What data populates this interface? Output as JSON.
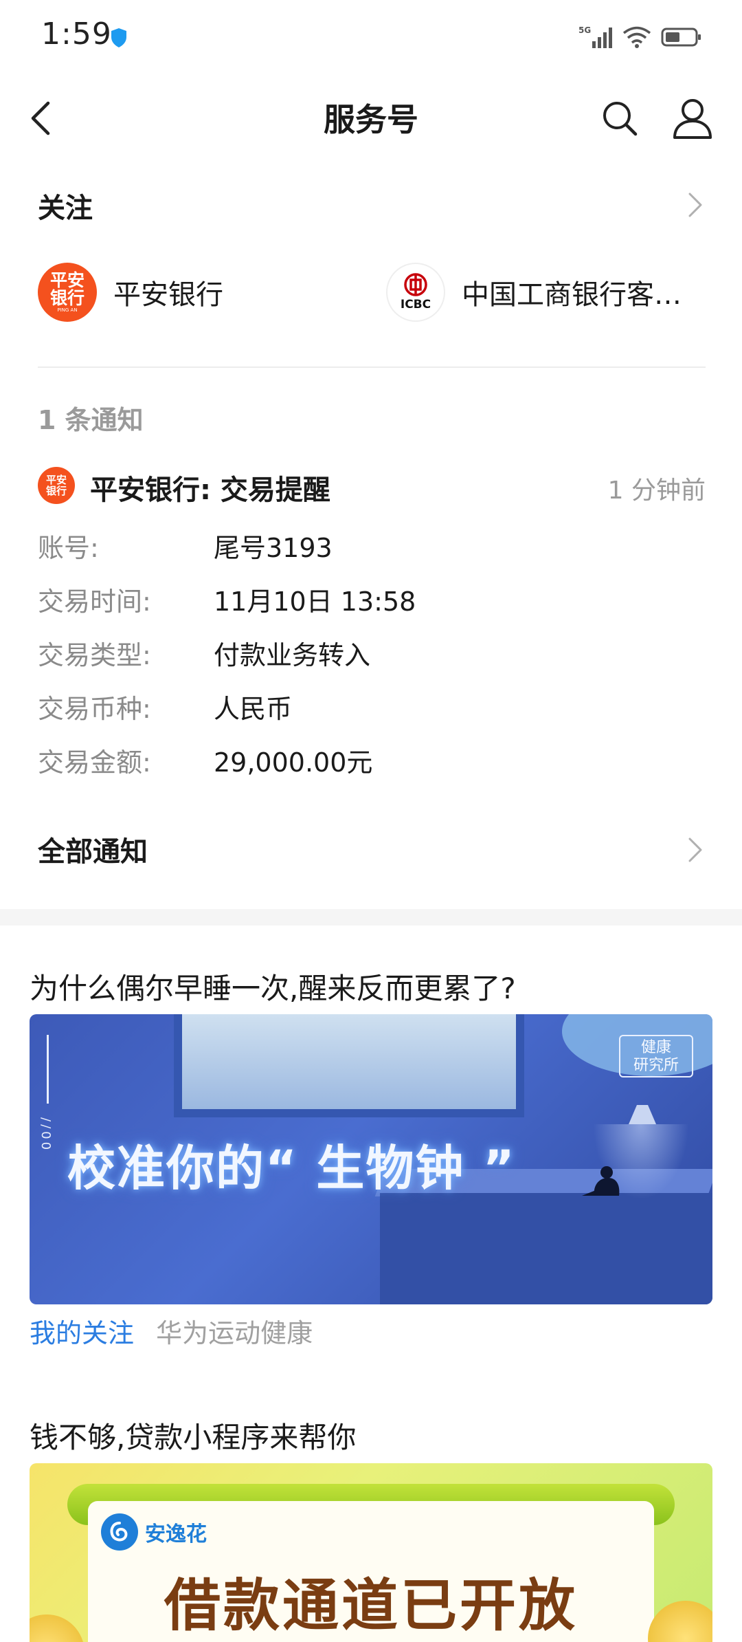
{
  "status_bar": {
    "time": "1:59",
    "network": "5G"
  },
  "nav": {
    "title": "服务号"
  },
  "follow": {
    "title": "关注",
    "accounts": [
      {
        "name": "平安银行",
        "logo_lines": [
          "平安",
          "银行"
        ],
        "logo_sub": "PING AN",
        "color": "#f4511e"
      },
      {
        "name": "中国工商银行客…",
        "logo_text": "ICBC",
        "color": "#c7000b"
      }
    ]
  },
  "notice": {
    "count_label": "1 条通知",
    "sender_title": "平安银行: 交易提醒",
    "time_ago": "1 分钟前",
    "rows": [
      {
        "label": "账号:",
        "value": "尾号3193"
      },
      {
        "label": "交易时间:",
        "value": "11月10日 13:58"
      },
      {
        "label": "交易类型:",
        "value": "付款业务转入"
      },
      {
        "label": "交易币种:",
        "value": "人民币"
      },
      {
        "label": "交易金额:",
        "value": "29,000.00元"
      }
    ],
    "all_label": "全部通知"
  },
  "articles": [
    {
      "title": "为什么偶尔早睡一次,醒来反而更累了?",
      "banner_text": "校准你的“ 生物钟 ”",
      "banner_tag": [
        "健康",
        "研究所"
      ],
      "banner_side": "//00",
      "source_follow": "我的关注",
      "source_name": "华为运动健康"
    },
    {
      "title": "钱不够,贷款小程序来帮你",
      "brand": "安逸花",
      "banner_text": "借款通道已开放"
    }
  ],
  "colors": {
    "accent_blue": "#2b7de1",
    "pingan_orange": "#f4511e",
    "icbc_red": "#c7000b",
    "muted": "#9a9a9a"
  }
}
